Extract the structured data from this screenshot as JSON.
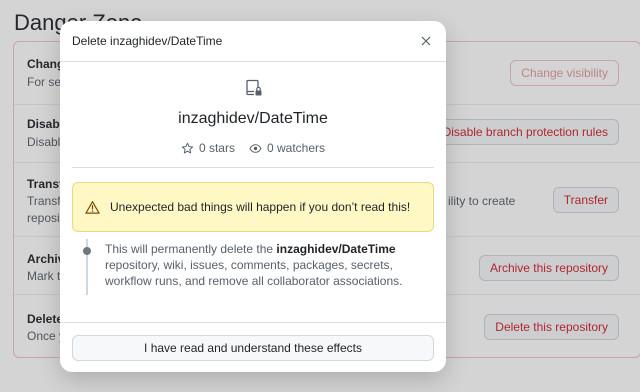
{
  "page": {
    "heading": "Danger Zone",
    "rows": [
      {
        "title": "Chang",
        "desc": "For sec",
        "button": "Change visibility"
      },
      {
        "title": "Disabl",
        "desc": "Disable",
        "button": "Disable branch protection rules"
      },
      {
        "title": "Transfe",
        "desc": "Transfe",
        "desc2": "reposit",
        "extra": "ility to create",
        "button": "Transfer"
      },
      {
        "title": "Archiv",
        "desc": "Mark t",
        "button": "Archive this repository"
      },
      {
        "title": "Delete",
        "desc": "Once y",
        "button": "Delete this repository"
      }
    ]
  },
  "modal": {
    "title": "Delete inzaghidev/DateTime",
    "repo_name": "inzaghidev/DateTime",
    "stars": "0 stars",
    "watchers": "0 watchers",
    "warning": "Unexpected bad things will happen if you don’t read this!",
    "effect": {
      "prefix": "This will permanently delete the ",
      "repo": "inzaghidev/DateTime",
      "suffix": " repository, wiki, issues, comments, packages, secrets, workflow runs, and remove all collaborator associations."
    },
    "confirm_label": "I have read and understand these effects"
  },
  "colors": {
    "danger": "#cf222e",
    "warning_bg": "#fff8c5",
    "overlay": "rgba(60,60,60,0.22)"
  },
  "icons": {
    "close": "close-icon",
    "repo": "repo-locked-icon",
    "star": "star-icon",
    "eye": "eye-icon",
    "warning": "alert-icon"
  }
}
